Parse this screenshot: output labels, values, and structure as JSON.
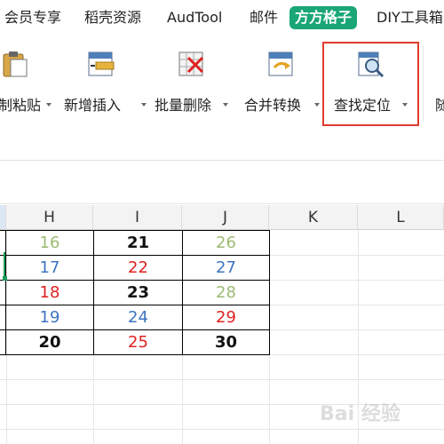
{
  "menu_tabs": [
    {
      "label": "会员专享"
    },
    {
      "label": "稻壳资源"
    },
    {
      "label": "AudTool"
    },
    {
      "label": "邮件"
    },
    {
      "label": "方方格子"
    },
    {
      "label": "DIY工具箱"
    }
  ],
  "ribbon": {
    "tools": [
      {
        "label": "制粘贴"
      },
      {
        "label": "新增插入"
      },
      {
        "label": "批量删除"
      },
      {
        "label": "合并转换"
      },
      {
        "label": "查找定位"
      },
      {
        "label": "随"
      }
    ]
  },
  "sheet": {
    "columns": [
      "",
      "H",
      "I",
      "J",
      "K",
      "L"
    ],
    "rows": [
      [
        {
          "v": "16",
          "c": "#9bbb73"
        },
        {
          "v": "21",
          "c": "#111111"
        },
        {
          "v": "26",
          "c": "#9bbb73"
        }
      ],
      [
        {
          "v": "17",
          "c": "#3d74c0"
        },
        {
          "v": "22",
          "c": "#e02020"
        },
        {
          "v": "27",
          "c": "#3d74c0"
        }
      ],
      [
        {
          "v": "18",
          "c": "#e02020"
        },
        {
          "v": "23",
          "c": "#111111"
        },
        {
          "v": "28",
          "c": "#9bbb73"
        }
      ],
      [
        {
          "v": "19",
          "c": "#3d74c0"
        },
        {
          "v": "24",
          "c": "#3d74c0"
        },
        {
          "v": "29",
          "c": "#e02020"
        }
      ],
      [
        {
          "v": "20",
          "c": "#111111"
        },
        {
          "v": "25",
          "c": "#e02020"
        },
        {
          "v": "30",
          "c": "#111111"
        }
      ]
    ]
  },
  "watermark": {
    "text": "Bai 经验"
  },
  "colors": {
    "accent_tab": "#1aa676",
    "highlight": "#e23b2e"
  }
}
